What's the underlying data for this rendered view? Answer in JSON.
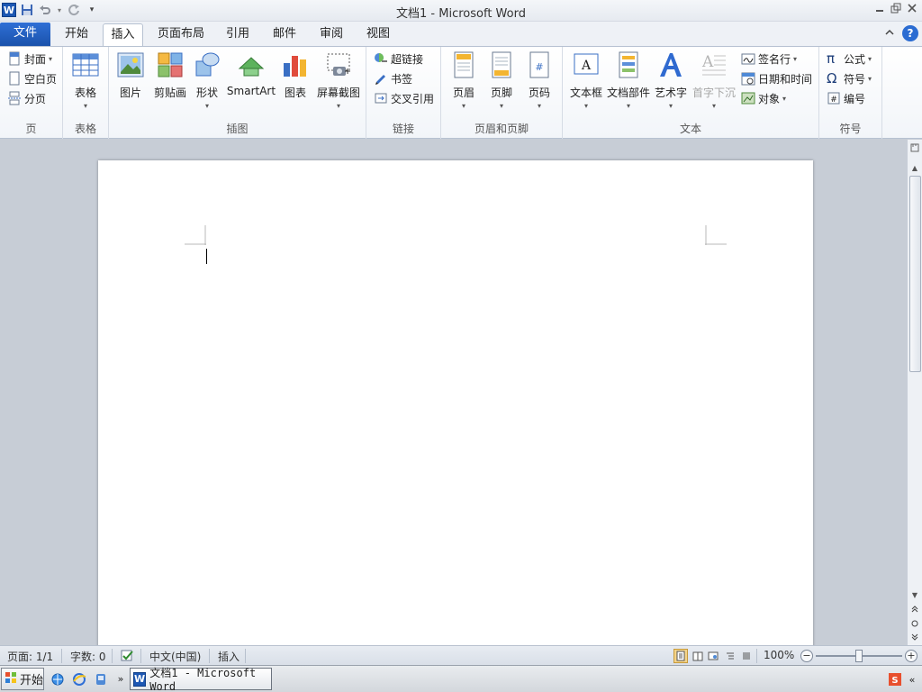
{
  "window": {
    "title": "文档1  -  Microsoft Word"
  },
  "tabs": [
    {
      "label": "文件"
    },
    {
      "label": "开始"
    },
    {
      "label": "插入"
    },
    {
      "label": "页面布局"
    },
    {
      "label": "引用"
    },
    {
      "label": "邮件"
    },
    {
      "label": "审阅"
    },
    {
      "label": "视图"
    }
  ],
  "ribbon": {
    "pages": {
      "label": "页",
      "cover": "封面",
      "blank": "空白页",
      "break": "分页"
    },
    "tables": {
      "label": "表格",
      "table": "表格"
    },
    "illustrations": {
      "label": "插图",
      "picture": "图片",
      "clipart": "剪贴画",
      "shapes": "形状",
      "smartart": "SmartArt",
      "chart": "图表",
      "screenshot": "屏幕截图"
    },
    "links": {
      "label": "链接",
      "hyperlink": "超链接",
      "bookmark": "书签",
      "crossref": "交叉引用"
    },
    "header_footer": {
      "label": "页眉和页脚",
      "header": "页眉",
      "footer": "页脚",
      "page_number": "页码"
    },
    "text": {
      "label": "文本",
      "textbox": "文本框",
      "quickparts": "文档部件",
      "wordart": "艺术字",
      "dropcap": "首字下沉",
      "signature": "签名行",
      "datetime": "日期和时间",
      "object": "对象"
    },
    "symbols": {
      "label": "符号",
      "equation": "公式",
      "symbol": "符号",
      "number": "编号"
    }
  },
  "statusbar": {
    "page": "页面: 1/1",
    "words": "字数: 0",
    "language": "中文(中国)",
    "mode": "插入",
    "zoom": "100%"
  },
  "taskbar": {
    "start": "开始",
    "task": "文档1 - Microsoft Word"
  }
}
